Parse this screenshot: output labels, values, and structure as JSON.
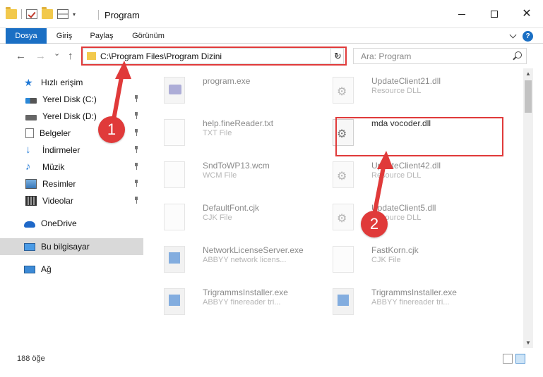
{
  "window": {
    "title": "Program",
    "minimize_label": "",
    "maximize_label": "",
    "close_label": "✕"
  },
  "ribbon": {
    "tabs": [
      {
        "label": "Dosya",
        "active": true
      },
      {
        "label": "Giriş",
        "active": false
      },
      {
        "label": "Paylaş",
        "active": false
      },
      {
        "label": "Görünüm",
        "active": false
      }
    ],
    "help_label": "?"
  },
  "nav": {
    "back_icon": "←",
    "forward_icon": "→",
    "recent_icon": "⌄",
    "up_icon": "↑",
    "address": "C:\\Program Files\\Program Dizini",
    "address_dropdown": "⌄",
    "refresh_icon": "↻",
    "search_placeholder": "Ara: Program"
  },
  "sidebar": {
    "items": [
      {
        "label": "Hızlı erişim",
        "icon": "star-icon",
        "pinned": false,
        "selected": false
      },
      {
        "label": "Yerel Disk (C:)",
        "icon": "disk-icon",
        "pinned": true,
        "selected": false
      },
      {
        "label": "Yerel Disk (D:)",
        "icon": "disk-icon",
        "pinned": true,
        "selected": false
      },
      {
        "label": "Belgeler",
        "icon": "documents-icon",
        "pinned": true,
        "selected": false
      },
      {
        "label": "İndirmeler",
        "icon": "download-icon",
        "pinned": true,
        "selected": false
      },
      {
        "label": "Müzik",
        "icon": "music-icon",
        "pinned": true,
        "selected": false
      },
      {
        "label": "Resimler",
        "icon": "pictures-icon",
        "pinned": true,
        "selected": false
      },
      {
        "label": "Videolar",
        "icon": "videos-icon",
        "pinned": true,
        "selected": false
      },
      {
        "label": "OneDrive",
        "icon": "cloud-icon",
        "pinned": false,
        "selected": false
      },
      {
        "label": "Bu bilgisayar",
        "icon": "computer-icon",
        "pinned": false,
        "selected": true
      },
      {
        "label": "Ağ",
        "icon": "network-icon",
        "pinned": false,
        "selected": false
      }
    ]
  },
  "files": {
    "left": [
      {
        "name": "program.exe",
        "type": "",
        "icon": "program-icon"
      },
      {
        "name": "help.fineReader.txt",
        "type": "TXT File",
        "icon": "text-file-icon"
      },
      {
        "name": "SndToWP13.wcm",
        "type": "WCM File",
        "icon": "file-icon"
      },
      {
        "name": "DefaultFont.cjk",
        "type": "CJK File",
        "icon": "file-icon"
      },
      {
        "name": "NetworkLicenseServer.exe",
        "type": "ABBYY network licens...",
        "icon": "exe-icon"
      },
      {
        "name": "TrigrammsInstaller.exe",
        "type": "ABBYY finereader tri...",
        "icon": "exe-icon"
      }
    ],
    "right": [
      {
        "name": "UpdateClient21.dll",
        "type": "Resource DLL",
        "icon": "dll-icon",
        "highlight": false
      },
      {
        "name": "mda vocoder.dll",
        "type": "",
        "icon": "dll-icon",
        "highlight": true
      },
      {
        "name": "UpdateClient42.dll",
        "type": "Resource DLL",
        "icon": "dll-icon",
        "highlight": false
      },
      {
        "name": "UpdateClient5.dll",
        "type": "Resource DLL",
        "icon": "dll-icon",
        "highlight": false
      },
      {
        "name": "FastKorn.cjk",
        "type": "CJK File",
        "icon": "file-icon",
        "highlight": false
      },
      {
        "name": "TrigrammsInstaller.exe",
        "type": "ABBYY finereader tri...",
        "icon": "exe-icon",
        "highlight": false
      }
    ]
  },
  "status": {
    "item_count": "188 öğe"
  },
  "callouts": [
    {
      "number": "1"
    },
    {
      "number": "2"
    }
  ],
  "colors": {
    "accent": "#1a6fc4",
    "highlight_red": "#e03a3a",
    "selected_bg": "#d9d9d9"
  }
}
